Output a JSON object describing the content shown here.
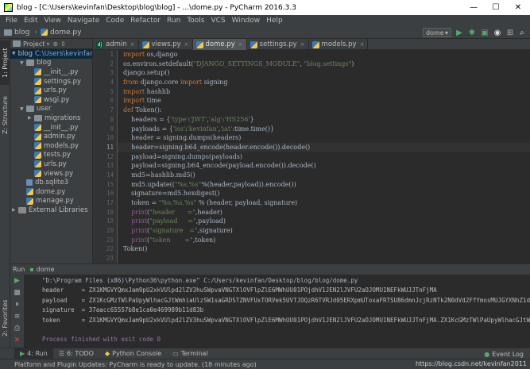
{
  "window": {
    "title": "blog - [C:\\Users\\kevinfan\\Desktop\\blog\\blog] - ...\\dome.py - PyCharm 2016.3.3",
    "minimize": "—",
    "maximize": "☐",
    "close": "✕"
  },
  "menu": [
    "File",
    "Edit",
    "View",
    "Navigate",
    "Code",
    "Refactor",
    "Run",
    "Tools",
    "VCS",
    "Window",
    "Help"
  ],
  "navbar": {
    "crumbs": [
      "blog",
      "dome.py"
    ],
    "run_config": "dome"
  },
  "left_strip": {
    "project": "1: Project",
    "structure": "Z: Structure",
    "favorites": "2: Favorites"
  },
  "project_panel": {
    "header": "Project",
    "root": "blog",
    "root_path": "C:\\Users\\kevinfan",
    "items": [
      {
        "label": "blog",
        "type": "folder",
        "level": 1
      },
      {
        "label": "__init__.py",
        "type": "py",
        "level": 2
      },
      {
        "label": "settings.py",
        "type": "py",
        "level": 2
      },
      {
        "label": "urls.py",
        "type": "py",
        "level": 2
      },
      {
        "label": "wsgi.py",
        "type": "py",
        "level": 2
      },
      {
        "label": "user",
        "type": "folder",
        "level": 1
      },
      {
        "label": "migrations",
        "type": "folder",
        "level": 2
      },
      {
        "label": "__init__.py",
        "type": "py",
        "level": 2
      },
      {
        "label": "admin.py",
        "type": "py",
        "level": 2
      },
      {
        "label": "models.py",
        "type": "py",
        "level": 2
      },
      {
        "label": "tests.py",
        "type": "py",
        "level": 2
      },
      {
        "label": "urls.py",
        "type": "py",
        "level": 2
      },
      {
        "label": "views.py",
        "type": "py",
        "level": 2
      },
      {
        "label": "db.sqlite3",
        "type": "db",
        "level": 1
      },
      {
        "label": "dome.py",
        "type": "py",
        "level": 1
      },
      {
        "label": "manage.py",
        "type": "py",
        "level": 1
      },
      {
        "label": "External Libraries",
        "type": "lib",
        "level": 0
      }
    ]
  },
  "tabs": [
    {
      "label": "admin",
      "type": "dj"
    },
    {
      "label": "views.py",
      "type": "py"
    },
    {
      "label": "dome.py",
      "type": "py",
      "active": true
    },
    {
      "label": "settings.py",
      "type": "py"
    },
    {
      "label": "models.py",
      "type": "py"
    }
  ],
  "editor": {
    "line_numbers": [
      "1",
      "2",
      "3",
      "4",
      "5",
      "6",
      "7",
      "8",
      "9",
      "10",
      "11",
      "12",
      "13",
      "14",
      "15",
      "16",
      "17",
      "18",
      "19",
      "20",
      "21",
      "22",
      "23"
    ],
    "current_line": 11,
    "lines": [
      "import os,django",
      "os.environ.setdefault(\"DJANGO_SETTINGS_MODULE\", \"blog.settings\")",
      "django.setup()",
      "from django.core import signing",
      "import hashlib",
      "import time",
      "def Token():",
      "    headers = {'type':'JWT','alg':'HS256'}",
      "    payloads = {'iss':'kevinfan','iat':time.time()}",
      "    header = signing.dumps(headers)",
      "    header=signing.b64_encode(header.encode()).decode()",
      "    payload=signing.dumps(payloads)",
      "    payload=signing.b64_encode(payload.encode()).decode()",
      "    md5=hashlib.md5()",
      "    md5.update((\"%s.%s\"%(header,payload)).encode())",
      "    signature=md5.hexdigest()",
      "    token = \"%s.%s.%s\" % (header, payload, signature)",
      "    print(\"header      =\",header)",
      "    print(\"payload     =\",payload)",
      "    print(\"signature   =\",signature)",
      "    print(\"token       =\",token)",
      "Token()",
      ""
    ]
  },
  "run_panel": {
    "label": "Run",
    "config": "dome",
    "console": [
      "\"D:\\Program Files (x86)\\Python36\\python.exe\" C:/Users/kevinfan/Desktop/blog/blog/dome.py",
      "header     = ZX1KMGVYQmxJam9pU2xkVUlpd2lZV3huSWpvaVNGTXlOVFlpZlE6MWhUU01POjdhV1JEN2lJVFU2aOJOMU1NEFkWUJJTnFjMA",
      "payload    = ZX1KcGMzTWlPaUpyWlhacGJtWmhiaUlzSW1saGRDSTZNVFUxTORVek5UVTJOQzR6TVRJd05ERXpmUToxaFRTSU86dmnJcjRzNTk2N0dVd2FfYmosMUJGYXNhZ1dR",
      "signature  = 37aacc65557b8e1ca0e469989b11d83b",
      "token      = ZX1KMGVYQmxJam9pU2xkVUlpd2lZV3huSWpvaVNGTXlOVFlpZlE6MWhUU01POjdhV1JEN2lJVFU2aOJOMU1NEFkWUJJTnFjMA.ZX1KcGMzTWlPaUpyWlhacGJtWmhiaUlzSW1saGRDSTZ",
      "",
      "Process finished with exit code 0"
    ]
  },
  "bottom_tabs": [
    {
      "label": "4: Run",
      "active": true
    },
    {
      "label": "6: TODO"
    },
    {
      "label": "Python Console"
    },
    {
      "label": "Terminal"
    }
  ],
  "event_log": "Event Log",
  "status": "Platform and Plugin Updates: PyCharm is ready to update. (18 minutes ago)",
  "watermark": "https://blog.csdn.net/kevinfan2011"
}
